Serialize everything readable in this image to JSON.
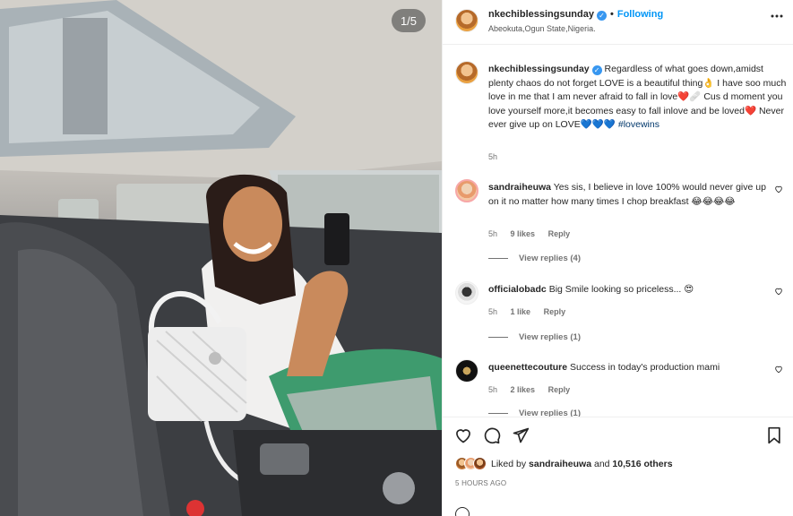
{
  "post": {
    "counter": "1/5",
    "author": "nkechiblessingsunday",
    "verified_mark": "✓",
    "following_label": "Following",
    "location": "Abeokuta,Ogun State,Nigeria.",
    "more_icon": "more-options-icon"
  },
  "caption": {
    "username": "nkechiblessingsunday",
    "text": "Regardless of what goes down,amidst plenty chaos do not forget LOVE is a beautiful thing👌 I have soo much love in me that I am never afraid to fall in love❤️🩹 Cus d moment you love yourself more,it becomes easy to fall inlove and be loved❤️ Never ever give up on LOVE💙💙💙",
    "hashtag": "#lovewins",
    "time": "5h"
  },
  "comments": [
    {
      "username": "sandraiheuwa",
      "text": "Yes sis, I believe in love 100% would never give up on it no matter how many times I chop breakfast 😂😂😂😂",
      "time": "5h",
      "likes": "9 likes",
      "reply": "Reply",
      "view_replies": "View replies (4)"
    },
    {
      "username": "officialobadc",
      "text": "Big Smile looking so priceless... 😍",
      "time": "5h",
      "likes": "1 like",
      "reply": "Reply",
      "view_replies": "View replies (1)"
    },
    {
      "username": "queenettecouture",
      "text": "Success in today's production mami",
      "time": "5h",
      "likes": "2 likes",
      "reply": "Reply",
      "view_replies": "View replies (1)"
    }
  ],
  "footer": {
    "liked_prefix": "Liked by ",
    "liked_user": "sandraiheuwa",
    "liked_mid": " and ",
    "liked_count": "10,516 others",
    "time_ago": "5 HOURS AGO"
  },
  "colors": {
    "accent": "#0095f6",
    "verified": "#3897f0",
    "like_heart": "#ed4956"
  }
}
